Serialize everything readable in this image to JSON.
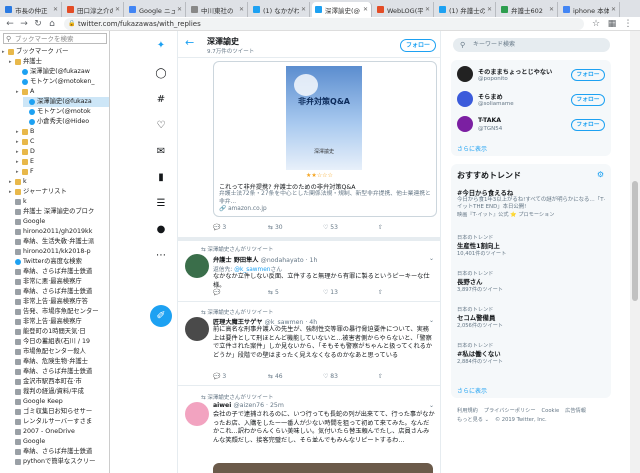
{
  "tabs": [
    {
      "label": "市長の仲正",
      "color": "#2a7ae2"
    },
    {
      "label": "田口淳之介の",
      "color": "#e34c26"
    },
    {
      "label": "Google ニュー",
      "color": "#4285f4"
    },
    {
      "label": "中川東社の",
      "color": "#888888"
    },
    {
      "label": "(1) なかがわ",
      "color": "#1da1f2"
    },
    {
      "label": "深澤諭史(@",
      "color": "#1da1f2"
    },
    {
      "label": "WebLOG(平",
      "color": "#e34c26"
    },
    {
      "label": "(1) 弁護士の",
      "color": "#1da1f2"
    },
    {
      "label": "弁護士602",
      "color": "#2e9e4f"
    },
    {
      "label": "iphone 本体",
      "color": "#4285f4"
    }
  ],
  "address": "twitter.com/fukazawas/with_replies",
  "bookmarks": {
    "search_placeholder": "ブックマークを検索",
    "items": [
      {
        "t": "ブックマーク バー",
        "k": "folder",
        "d": 0
      },
      {
        "t": "弁護士",
        "k": "folder",
        "d": 1
      },
      {
        "t": "深澤諭史(@fukazaw",
        "k": "bird",
        "d": 2
      },
      {
        "t": "モトケン(@motoken_",
        "k": "bird",
        "d": 2
      },
      {
        "t": "A",
        "k": "folder",
        "d": 2
      },
      {
        "t": "深澤諭史(@fukaza",
        "k": "bird",
        "d": 3,
        "sel": true
      },
      {
        "t": "モトケン(@motok",
        "k": "bird",
        "d": 3
      },
      {
        "t": "小倉秀夫(@Hideo",
        "k": "bird",
        "d": 3
      },
      {
        "t": "B",
        "k": "folder",
        "d": 2
      },
      {
        "t": "C",
        "k": "folder",
        "d": 2
      },
      {
        "t": "D",
        "k": "folder",
        "d": 2
      },
      {
        "t": "E",
        "k": "folder",
        "d": 2
      },
      {
        "t": "F",
        "k": "folder",
        "d": 2
      },
      {
        "t": "k",
        "k": "folder",
        "d": 1
      },
      {
        "t": "ジャーナリスト",
        "k": "folder",
        "d": 1
      },
      {
        "t": "k",
        "k": "page",
        "d": 1
      },
      {
        "t": "弁護士 深澤諭史のブロク",
        "k": "page",
        "d": 1
      },
      {
        "t": "Google",
        "k": "page",
        "d": 1
      },
      {
        "t": "hirono2011/gh2019kk",
        "k": "page",
        "d": 1
      },
      {
        "t": "奉納、生活失敎·弁護士派",
        "k": "page",
        "d": 1
      },
      {
        "t": "hirono2011/kk2018-p",
        "k": "page",
        "d": 1
      },
      {
        "t": "Twitterの高度な検索",
        "k": "bird",
        "d": 1
      },
      {
        "t": "奉納、さらば弁護士鉄道",
        "k": "page",
        "d": 1
      },
      {
        "t": "非常に悪·最高検察庁",
        "k": "page",
        "d": 1
      },
      {
        "t": "奉納、さらば弁護士鉄道",
        "k": "page",
        "d": 1
      },
      {
        "t": "非常上告·最高検察庁答",
        "k": "page",
        "d": 1
      },
      {
        "t": "告発、市場序魚配センター",
        "k": "page",
        "d": 1
      },
      {
        "t": "非常上告·最高検察庁",
        "k": "page",
        "d": 1
      },
      {
        "t": "能登町の1時間天気·日",
        "k": "page",
        "d": 1
      },
      {
        "t": "今日の蓄組表(石川 / 19",
        "k": "page",
        "d": 1
      },
      {
        "t": "市場魚配センター殺人",
        "k": "page",
        "d": 1
      },
      {
        "t": "奉納、危険生物·弁護士",
        "k": "page",
        "d": 1
      },
      {
        "t": "奉納、さらば弁護士鉄道",
        "k": "page",
        "d": 1
      },
      {
        "t": "金沢市駅西本町在·市",
        "k": "page",
        "d": 1
      },
      {
        "t": "裁判の経過/資料/平成",
        "k": "page",
        "d": 1
      },
      {
        "t": "Google Keep",
        "k": "page",
        "d": 1
      },
      {
        "t": "ゴミ収集日お知らせサー",
        "k": "page",
        "d": 1
      },
      {
        "t": "レンタルサーバーすさま",
        "k": "page",
        "d": 1
      },
      {
        "t": "2007 - OneDrive",
        "k": "page",
        "d": 1
      },
      {
        "t": "Google",
        "k": "page",
        "d": 1
      },
      {
        "t": "奉納、さらば弁護士鉄道",
        "k": "page",
        "d": 1
      },
      {
        "t": "pythonで簡単なスクリー",
        "k": "page",
        "d": 1
      }
    ]
  },
  "nav_icons": [
    "twitter-logo-icon",
    "explore-icon",
    "hashtag-icon",
    "notifications-icon",
    "messages-icon",
    "bookmarks-icon",
    "lists-icon",
    "profile-icon",
    "more-icon"
  ],
  "timeline": {
    "name": "深澤諭史",
    "count": "9.7万件のツイート",
    "follow": "フォロー",
    "card": {
      "book_title": "非弁対策Q&A",
      "book_author": "深澤諭史",
      "stars": "★★☆☆☆",
      "title": "これって非弁提携? 弁護士のための非弁対策Q&A",
      "desc": "弁護士法72条・27条を中心とした関係法規・規制、新型非弁提携、他士業連携と非弁...",
      "url": "amazon.co.jp"
    },
    "card_actions": {
      "reply": "3",
      "retweet": "30",
      "like": "53"
    },
    "tweet1": {
      "retweet": "深澤諭史さんがリツイート",
      "name": "弁護士 野田隼人",
      "handle": "@nodahayato · 1h",
      "reply": "返信先: ",
      "reply_to": "@k_sawmen",
      "reply_suffix": "さん",
      "text": "なかなか立件しない反面、立件すると無理から有罪に製るというピーキーな仕様。",
      "reply_n": "",
      "rt_n": "5",
      "like_n": "13"
    },
    "tweet2": {
      "retweet": "深澤諭史さんがリツイート",
      "name": "匠理大魔王サゲヤ",
      "handle": "@k_sawmen · 4h",
      "text": "前に高名な刑事弁護人の先生が、強制性交等罪の暴行脅迫要件について、実務上は要件として刑ほとんど機能していないと…被害者側からやらないと、「警察で立件された案件」しか見ないから、「そもそも警察がちゃんと扱ってくれるかどうか」段階での壁はまったく見えなくなるのかなあと思っている",
      "reply_n": "3",
      "rt_n": "46",
      "like_n": "83"
    },
    "tweet3": {
      "retweet": "深澤諭史さんがリツイート",
      "name": "aiwei",
      "handle": "@aizen76 · 25m",
      "text": "会社の子で逮捕されるのに、いつ行っても長蛇の列が出来てて、行った事がなかったお店、入購をしたー一番人が少ない時間を狙って初めて来てみた。なんだかこれ…訳わからんくらい美味しい。気付いたら替玉頼んでたし、店員さんみんな笑顔だし、接客完璧だし、そら並んでもみんなリピートするわ…"
    }
  },
  "right": {
    "search_placeholder": "キーワード検索",
    "who_to_follow": [
      {
        "name": "そのままちょっとじやない",
        "handle": "@poponito",
        "color": "#222222"
      },
      {
        "name": "そらまめ",
        "handle": "@soliamame",
        "color": "#3b5bdb"
      },
      {
        "name": "T-TAKA",
        "handle": "@TGN54",
        "color": "#7b1fa2"
      }
    ],
    "follow": "フォロー",
    "more": "さらに表示",
    "trends_title": "おすすめトレンド",
    "trends": [
      {
        "label": "",
        "name": "#今日から食えるね",
        "count": "",
        "desc": "今日から食1年3以上がるね!すべての謎が明らかになる…「T·イットTHE END」本日公開!",
        "extra": "映画『T·イット』公式 ⭐ プロモーション"
      },
      {
        "label": "日本のトレンド",
        "name": "生産性1割向上",
        "count": "10,401件のツイート",
        "desc": "",
        "extra": ""
      },
      {
        "label": "日本のトレンド",
        "name": "長野さん",
        "count": "3,897件のツイート",
        "desc": "",
        "extra": ""
      },
      {
        "label": "日本のトレンド",
        "name": "セコム警備員",
        "count": "2,056件のツイート",
        "desc": "",
        "extra": ""
      },
      {
        "label": "日本のトレンド",
        "name": "#私は働くない",
        "count": "2,884件のツイート",
        "desc": "",
        "extra": ""
      }
    ],
    "footer": [
      "利用規約",
      "プライバシーポリシー",
      "Cookie",
      "広告情報",
      "もっと見る ⌄",
      "© 2019 Twitter, Inc."
    ]
  }
}
